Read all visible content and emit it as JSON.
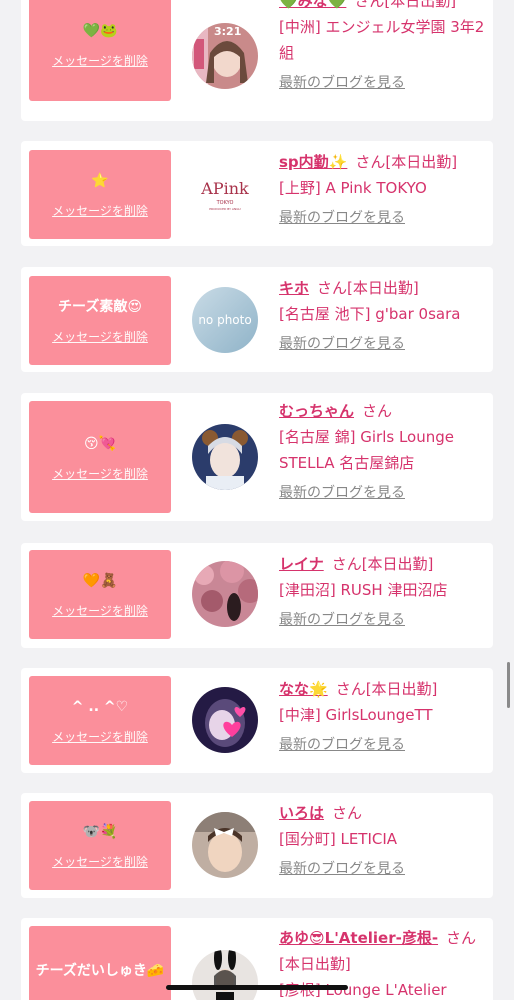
{
  "cards": [
    {
      "message": "💚🐸",
      "delete_label": "メッセージを削除",
      "name": "💚みな💚",
      "suffix": "さん[本日出勤]",
      "shop": "[中洲] エンジェル女学園 3年2組",
      "blog": "最新のブログを見る",
      "avatar": "photo-girl-pink",
      "avatar_color": "#c98a8a"
    },
    {
      "message": "⭐",
      "delete_label": "メッセージを削除",
      "name": "sp内勤✨",
      "suffix": "さん[本日出勤]",
      "shop": "[上野] A Pink TOKYO",
      "blog": "最新のブログを見る",
      "avatar": "apink-logo",
      "avatar_color": "#ffffff"
    },
    {
      "message": "チーズ素敵😍",
      "delete_label": "メッセージを削除",
      "name": "キホ",
      "suffix": "さん[本日出勤]",
      "shop": "[名古屋 池下] g'bar 0sara",
      "blog": "最新のブログを見る",
      "avatar": "no-photo",
      "avatar_color": "#aac6d6"
    },
    {
      "message": "😚💘",
      "delete_label": "メッセージを削除",
      "name": "むっちゃん",
      "suffix": "さん",
      "shop": "[名古屋 錦] Girls Lounge STELLA 名古屋錦店",
      "blog": "最新のブログを見る",
      "avatar": "photo-girl-bear-ears",
      "avatar_color": "#2d3e6e"
    },
    {
      "message": "🧡🧸",
      "delete_label": "メッセージを削除",
      "name": "レイナ",
      "suffix": "さん[本日出勤]",
      "shop": "[津田沼] RUSH 津田沼店",
      "blog": "最新のブログを見る",
      "avatar": "photo-cherry-blossom",
      "avatar_color": "#c77a86"
    },
    {
      "message": "^ .. ^♡",
      "delete_label": "メッセージを削除",
      "name": "なな🌟",
      "suffix": "さん[本日出勤]",
      "shop": "[中津] GirlsLoungeTT",
      "blog": "最新のブログを見る",
      "avatar": "photo-girl-hearts",
      "avatar_color": "#2a1f4a"
    },
    {
      "message": "🐨💐",
      "delete_label": "メッセージを削除",
      "name": "いろは",
      "suffix": "さん",
      "shop": "[国分町] LETICIA",
      "blog": "最新のブログを見る",
      "avatar": "photo-girl-bow",
      "avatar_color": "#b9a79c"
    },
    {
      "message": "チーズだいしゅき🧀",
      "delete_label": "",
      "name": "あゆ😎L'Atelier-彦根-",
      "suffix": "さん[本日出勤]",
      "shop": "[彦根] Lounge L'Atelier",
      "blog": "",
      "avatar": "photo-bunny-girl",
      "avatar_color": "#e6e2df"
    }
  ],
  "overlay_time": "3:21"
}
